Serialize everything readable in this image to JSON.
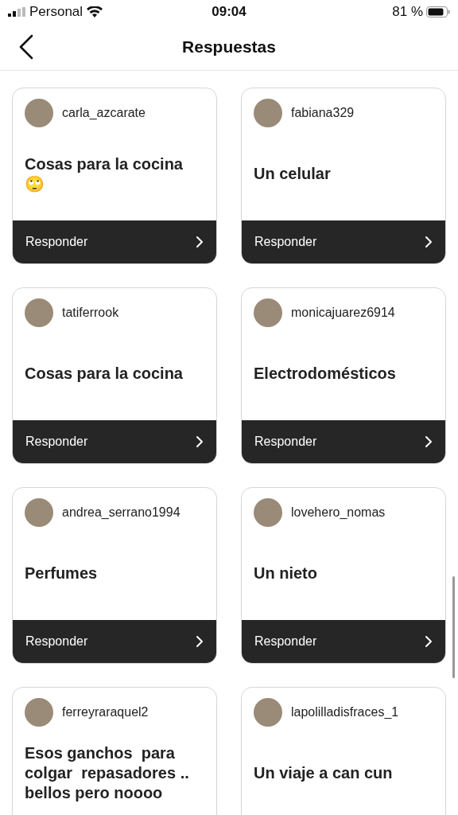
{
  "status_bar": {
    "carrier": "Personal",
    "time": "09:04",
    "battery": "81 %"
  },
  "nav": {
    "title": "Respuestas"
  },
  "cards": [
    {
      "username": "carla_azcarate",
      "text": "Cosas para la cocina 🙄",
      "reply": "Responder"
    },
    {
      "username": "fabiana329",
      "text": "Un celular",
      "reply": "Responder"
    },
    {
      "username": "tatiferrook",
      "text": "Cosas para la cocina",
      "reply": "Responder"
    },
    {
      "username": "monicajuarez6914",
      "text": "Electrodomésticos",
      "reply": "Responder"
    },
    {
      "username": "andrea_serrano1994",
      "text": "Perfumes",
      "reply": "Responder"
    },
    {
      "username": "lovehero_nomas",
      "text": "Un nieto",
      "reply": "Responder"
    },
    {
      "username": "ferreyraraquel2",
      "text": "Esos ganchos  para colgar  repasadores .. bellos pero noooo"
    },
    {
      "username": "lapolilladisfraces_1",
      "text": "Un viaje a can cun"
    }
  ]
}
